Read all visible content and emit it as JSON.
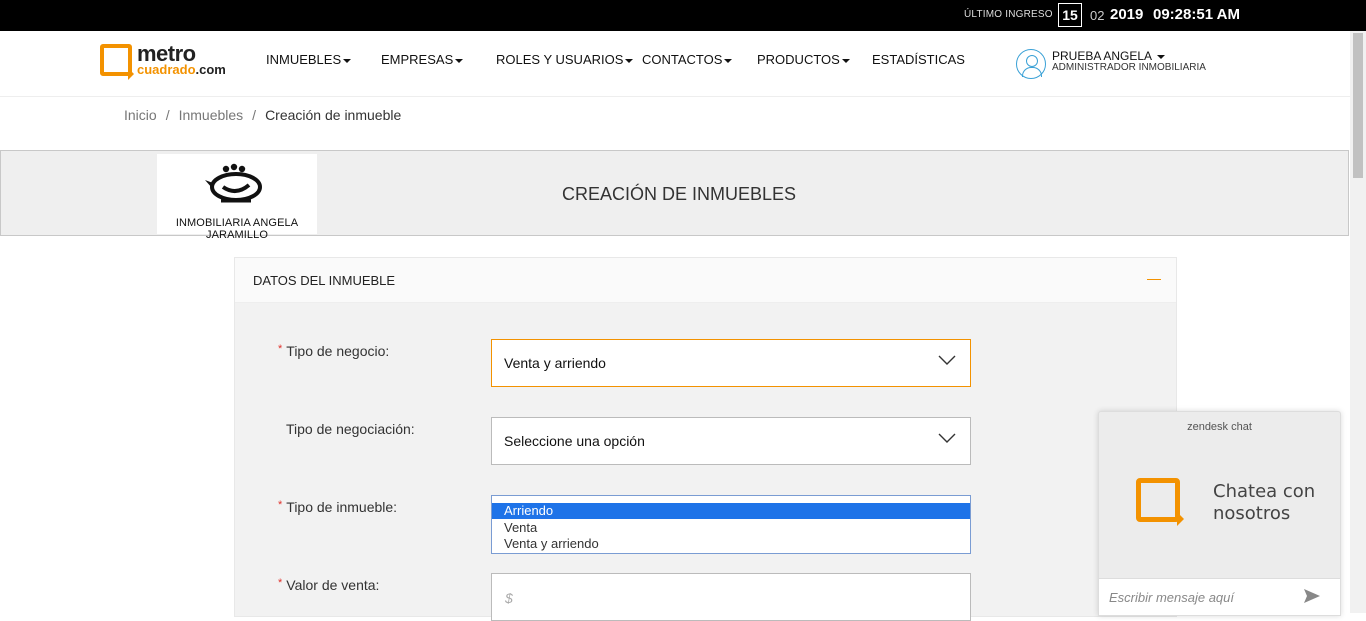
{
  "topbar": {
    "last_login_label": "ÚLTIMO INGRESO",
    "day": "15",
    "month": "02",
    "year": "2019",
    "time": "09:28:51 AM"
  },
  "logo": {
    "word1": "metro",
    "word2_part1": "cuadrado",
    "word2_part2": ".com"
  },
  "nav": {
    "items": [
      {
        "label": "INMUEBLES",
        "dropdown": true
      },
      {
        "label": "EMPRESAS",
        "dropdown": true
      },
      {
        "label": "ROLES Y USUARIOS",
        "dropdown": true
      },
      {
        "label": "CONTACTOS",
        "dropdown": true
      },
      {
        "label": "PRODUCTOS",
        "dropdown": true
      },
      {
        "label": "ESTADÍSTICAS",
        "dropdown": false
      }
    ],
    "user": {
      "name": "PRUEBA ANGELA",
      "role": "ADMINISTRADOR INMOBILIARIA"
    }
  },
  "breadcrumb": {
    "items": [
      "Inicio",
      "Inmuebles",
      "Creación de inmueble"
    ],
    "separator": "/"
  },
  "header": {
    "agency_name": "INMOBILIARIA ANGELA JARAMILLO",
    "title": "CREACIÓN DE INMUEBLES"
  },
  "panel": {
    "title": "DATOS DEL INMUEBLE",
    "fields": {
      "tipo_negocio": {
        "label": "Tipo de negocio:",
        "required": "*",
        "value": "Venta y arriendo"
      },
      "tipo_negociacion": {
        "label": "Tipo de negociación:",
        "value": "Seleccione una opción"
      },
      "tipo_inmueble": {
        "label": "Tipo de inmueble:",
        "required": "*",
        "options": [
          "Arriendo",
          "Venta",
          "Venta y arriendo"
        ],
        "selected_option": "Arriendo"
      },
      "valor_venta": {
        "label": "Valor de venta:",
        "required": "*",
        "placeholder": "$"
      }
    }
  },
  "chat": {
    "brand": "zendesk chat",
    "line1": "Chatea con",
    "line2": "nosotros",
    "input_placeholder": "Escribir mensaje aquí"
  },
  "colors": {
    "accent": "#f39200",
    "selected_option": "#1e73e8",
    "topbar": "#000000",
    "user_icon": "#3aa1d6"
  }
}
